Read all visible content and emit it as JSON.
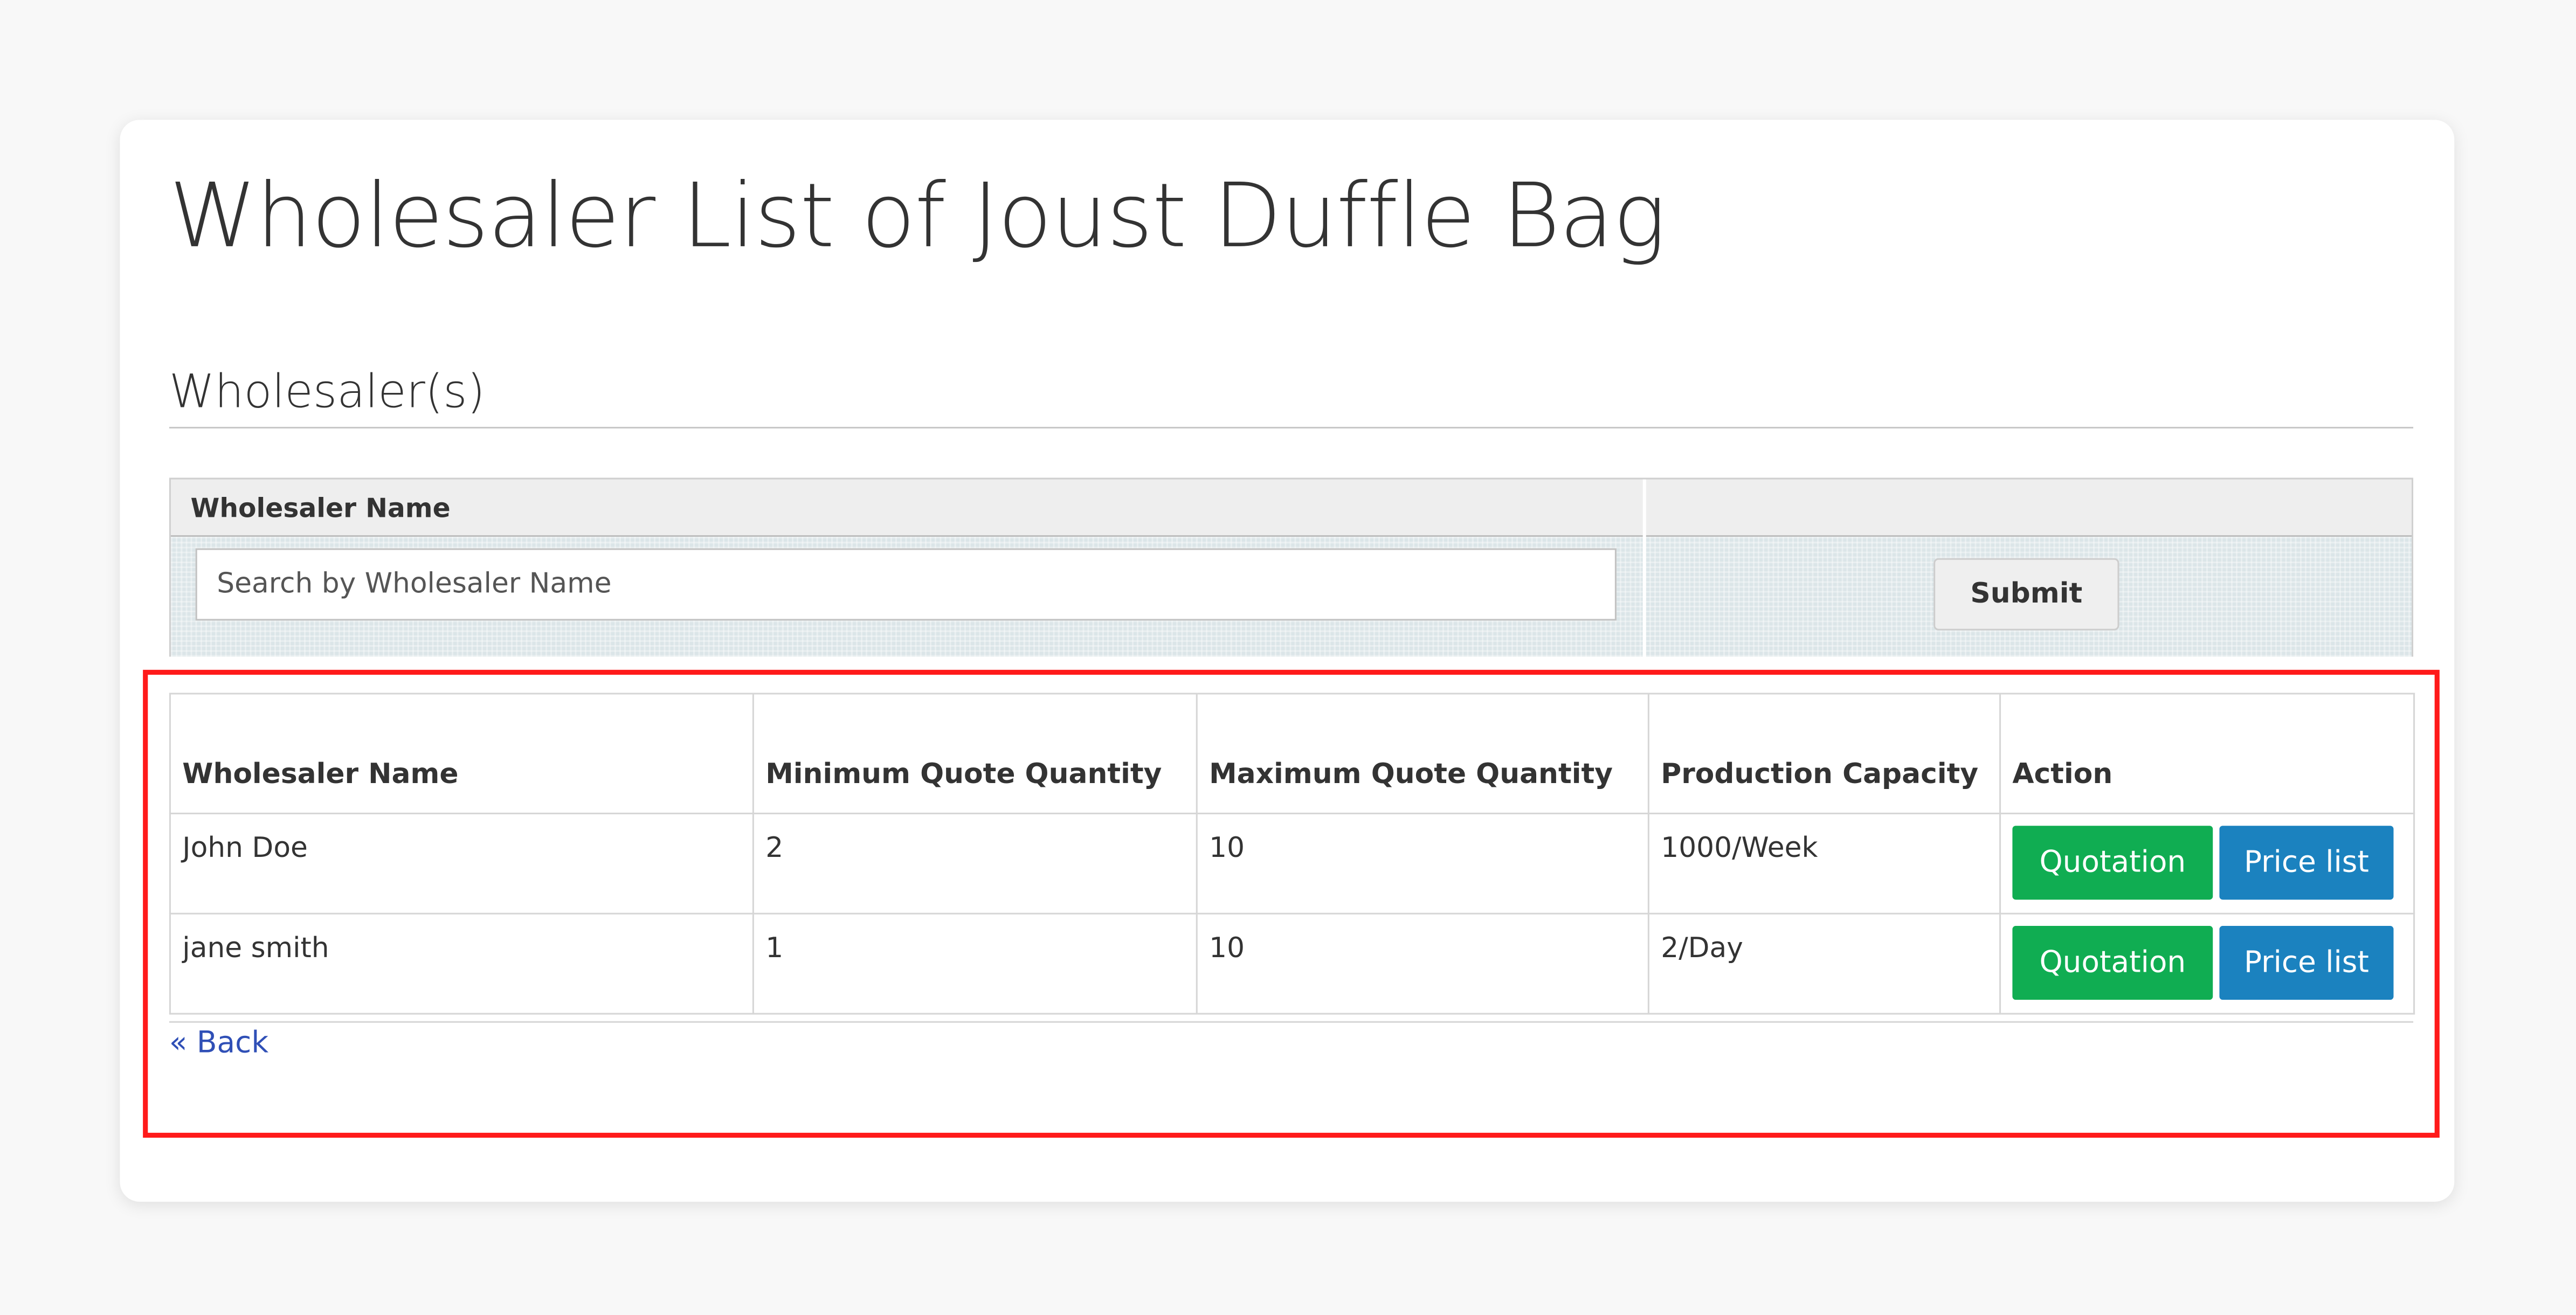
{
  "page": {
    "title": "Wholesaler List of Joust Duffle Bag",
    "section_title": "Wholesaler(s)"
  },
  "filter": {
    "column_label": "Wholesaler Name",
    "search_value": "",
    "search_placeholder": "Search by Wholesaler Name",
    "submit_label": "Submit"
  },
  "table": {
    "headers": {
      "name": "Wholesaler Name",
      "min_qty": "Minimum Quote Quantity",
      "max_qty": "Maximum Quote Quantity",
      "capacity": "Production Capacity",
      "action": "Action"
    },
    "rows": [
      {
        "name": "John Doe",
        "min_qty": "2",
        "max_qty": "10",
        "capacity": "1000/Week",
        "quote_label": "Quotation",
        "price_label": "Price list"
      },
      {
        "name": "jane smith",
        "min_qty": "1",
        "max_qty": "10",
        "capacity": "2/Day",
        "quote_label": "Quotation",
        "price_label": "Price list"
      }
    ]
  },
  "back_link": "« Back",
  "colors": {
    "quotation_button": "#10ad52",
    "price_list_button": "#1b82bf",
    "highlight_border": "#ff1a1a",
    "link": "#2f4fb6"
  }
}
